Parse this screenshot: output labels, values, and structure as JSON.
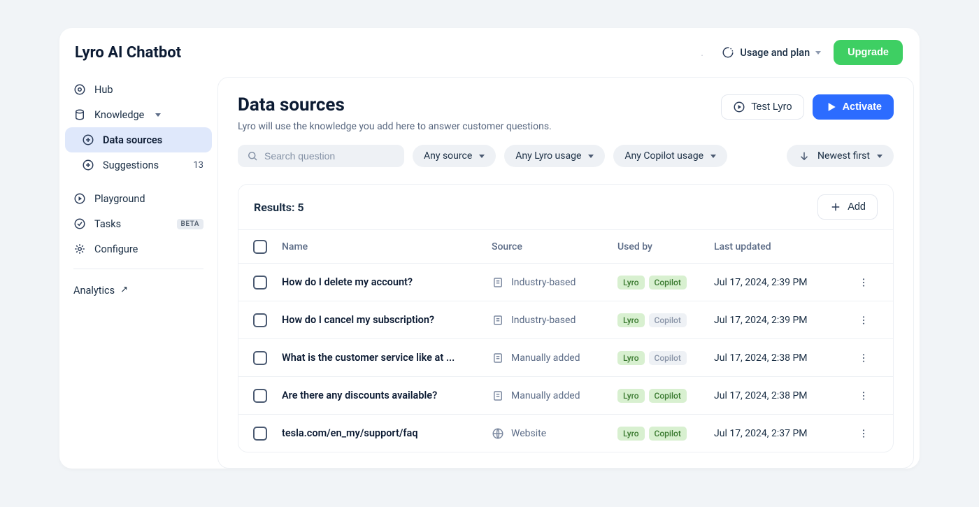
{
  "header": {
    "title": "Lyro AI Chatbot",
    "usage_label": "Usage and plan",
    "upgrade": "Upgrade"
  },
  "sidebar": {
    "items": [
      {
        "label": "Hub",
        "icon": "hub"
      },
      {
        "label": "Knowledge",
        "icon": "knowledge",
        "expandable": true
      },
      {
        "label": "Data sources",
        "icon": "datasource",
        "sub": true,
        "active": true
      },
      {
        "label": "Suggestions",
        "icon": "suggest",
        "sub": true,
        "count": "13"
      },
      {
        "label": "Playground",
        "icon": "play"
      },
      {
        "label": "Tasks",
        "icon": "tasks",
        "badge": "BETA"
      },
      {
        "label": "Configure",
        "icon": "config"
      }
    ],
    "analytics": "Analytics"
  },
  "main": {
    "title": "Data sources",
    "subtitle": "Lyro will use the knowledge you add here to answer customer questions.",
    "test_btn": "Test Lyro",
    "activate_btn": "Activate",
    "search_placeholder": "Search question",
    "filters": [
      "Any source",
      "Any Lyro usage",
      "Any Copilot usage"
    ],
    "sort": "Newest first",
    "results_label": "Results: 5",
    "add_btn": "Add",
    "columns": {
      "name": "Name",
      "source": "Source",
      "usedby": "Used by",
      "updated": "Last updated"
    },
    "rows": [
      {
        "name": "How do I delete my account?",
        "src": "Industry-based",
        "src_icon": "doc",
        "lyro": true,
        "copilot": true,
        "updated": "Jul 17, 2024, 2:39 PM"
      },
      {
        "name": "How do I cancel my subscription?",
        "src": "Industry-based",
        "src_icon": "doc",
        "lyro": true,
        "copilot": false,
        "updated": "Jul 17, 2024, 2:39 PM"
      },
      {
        "name": "What is the customer service like at ...",
        "src": "Manually added",
        "src_icon": "doc",
        "lyro": true,
        "copilot": false,
        "updated": "Jul 17, 2024, 2:38 PM"
      },
      {
        "name": "Are there any discounts available?",
        "src": "Manually added",
        "src_icon": "doc",
        "lyro": true,
        "copilot": true,
        "updated": "Jul 17, 2024, 2:38 PM"
      },
      {
        "name": "tesla.com/en_my/support/faq",
        "src": "Website",
        "src_icon": "globe",
        "lyro": true,
        "copilot": true,
        "updated": "Jul 17, 2024, 2:37 PM"
      }
    ],
    "pill_lyro": "Lyro",
    "pill_copilot": "Copilot"
  }
}
